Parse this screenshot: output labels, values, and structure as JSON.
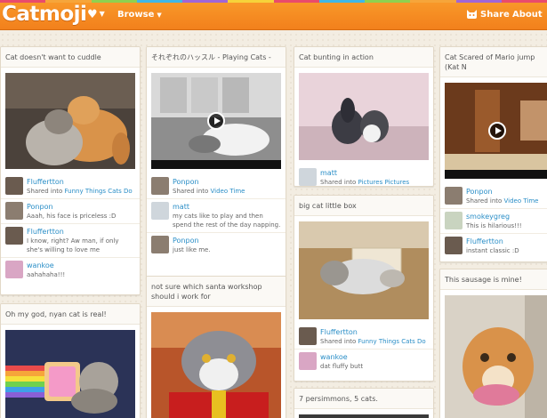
{
  "header": {
    "logo": "Catmoji",
    "heart_icon": "♥",
    "browse": "Browse",
    "share": "Share",
    "about": "About",
    "accent": "#f2801c",
    "rainbow": [
      "#e94b6c",
      "#f6a53a",
      "#8fd14f",
      "#3fb7e8",
      "#a066d6",
      "#f6d33a",
      "#e94b6c",
      "#3fb7e8",
      "#8fd14f",
      "#f6a53a",
      "#a066d6",
      "#e94b6c"
    ]
  },
  "cards": {
    "c1": {
      "title": "Cat doesn't want to cuddle",
      "entries": [
        {
          "user": "Fluffertton",
          "text": "Shared into ",
          "link": "Funny Things Cats Do"
        },
        {
          "user": "Ponpon",
          "text": "Aaah, his face is priceless :D"
        },
        {
          "user": "Fluffertton",
          "text": "I know, right? Aw man, if only she's willing to love me"
        },
        {
          "user": "wankoe",
          "text": "aahahaha!!!"
        }
      ]
    },
    "c2": {
      "title": "Oh my god, nyan cat is real!"
    },
    "c3": {
      "title": "それぞれのハッスル - Playing Cats -",
      "entries": [
        {
          "user": "Ponpon",
          "text": "Shared into ",
          "link": "Video Time"
        },
        {
          "user": "matt",
          "text": "my cats like to play and then spend the rest of the day napping."
        },
        {
          "user": "Ponpon",
          "text": "just like me."
        }
      ]
    },
    "c4": {
      "title": "not sure which santa workshop should i work for"
    },
    "c5": {
      "title": "Cat bunting in action",
      "entries": [
        {
          "user": "matt",
          "text": "Shared into ",
          "link": "Pictures Pictures Pictures"
        }
      ]
    },
    "c6": {
      "title": "big cat little box",
      "entries": [
        {
          "user": "Fluffertton",
          "text": "Shared into ",
          "link": "Funny Things Cats Do"
        },
        {
          "user": "wankoe",
          "text": "dat fluffy butt"
        }
      ]
    },
    "c7": {
      "title": "7 persimmons, 5 cats."
    },
    "c8": {
      "title": "Cat Scared of Mario jump (Kat N",
      "entries": [
        {
          "user": "Ponpon",
          "text": "Shared into ",
          "link": "Video Time"
        },
        {
          "user": "smokeygreg",
          "text": "This is hilarious!!!"
        },
        {
          "user": "Fluffertton",
          "text": "instant classic :D"
        }
      ]
    },
    "c9": {
      "title": "This sausage is mine!"
    }
  }
}
